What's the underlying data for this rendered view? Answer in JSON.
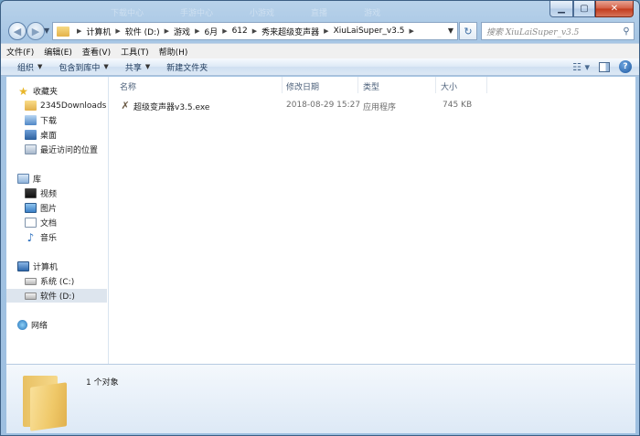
{
  "window": {
    "caption": {
      "min": "▁",
      "max": "▢",
      "close": "✕"
    },
    "ghost_tabs": [
      "下载中心",
      "手游中心",
      "小游戏",
      "直播",
      "游戏"
    ]
  },
  "address": {
    "crumbs": [
      "计算机",
      "软件 (D:)",
      "游戏",
      "6月",
      "612",
      "秀来超级变声器",
      "XiuLaiSuper_v3.5"
    ]
  },
  "search": {
    "placeholder": "搜索 XiuLaiSuper_v3.5"
  },
  "menu": [
    "文件(F)",
    "编辑(E)",
    "查看(V)",
    "工具(T)",
    "帮助(H)"
  ],
  "commands": [
    {
      "label": "组织",
      "dropdown": true
    },
    {
      "label": "包含到库中",
      "dropdown": true
    },
    {
      "label": "共享",
      "dropdown": true
    },
    {
      "label": "新建文件夹",
      "dropdown": false
    }
  ],
  "nav": {
    "favorites": {
      "label": "收藏夹",
      "items": [
        "2345Downloads",
        "下载",
        "桌面",
        "最近访问的位置"
      ]
    },
    "libraries": {
      "label": "库",
      "items": [
        "视频",
        "图片",
        "文档",
        "音乐"
      ]
    },
    "computer": {
      "label": "计算机",
      "items": [
        "系统 (C:)",
        "软件 (D:)"
      ],
      "selected": "软件 (D:)"
    },
    "network": {
      "label": "网络"
    }
  },
  "columns": {
    "name": "名称",
    "modified": "修改日期",
    "type": "类型",
    "size": "大小"
  },
  "files": [
    {
      "name": "超级变声器v3.5.exe",
      "modified": "2018-08-29 15:27",
      "type": "应用程序",
      "size": "745 KB"
    }
  ],
  "details": {
    "count": "1 个对象"
  }
}
